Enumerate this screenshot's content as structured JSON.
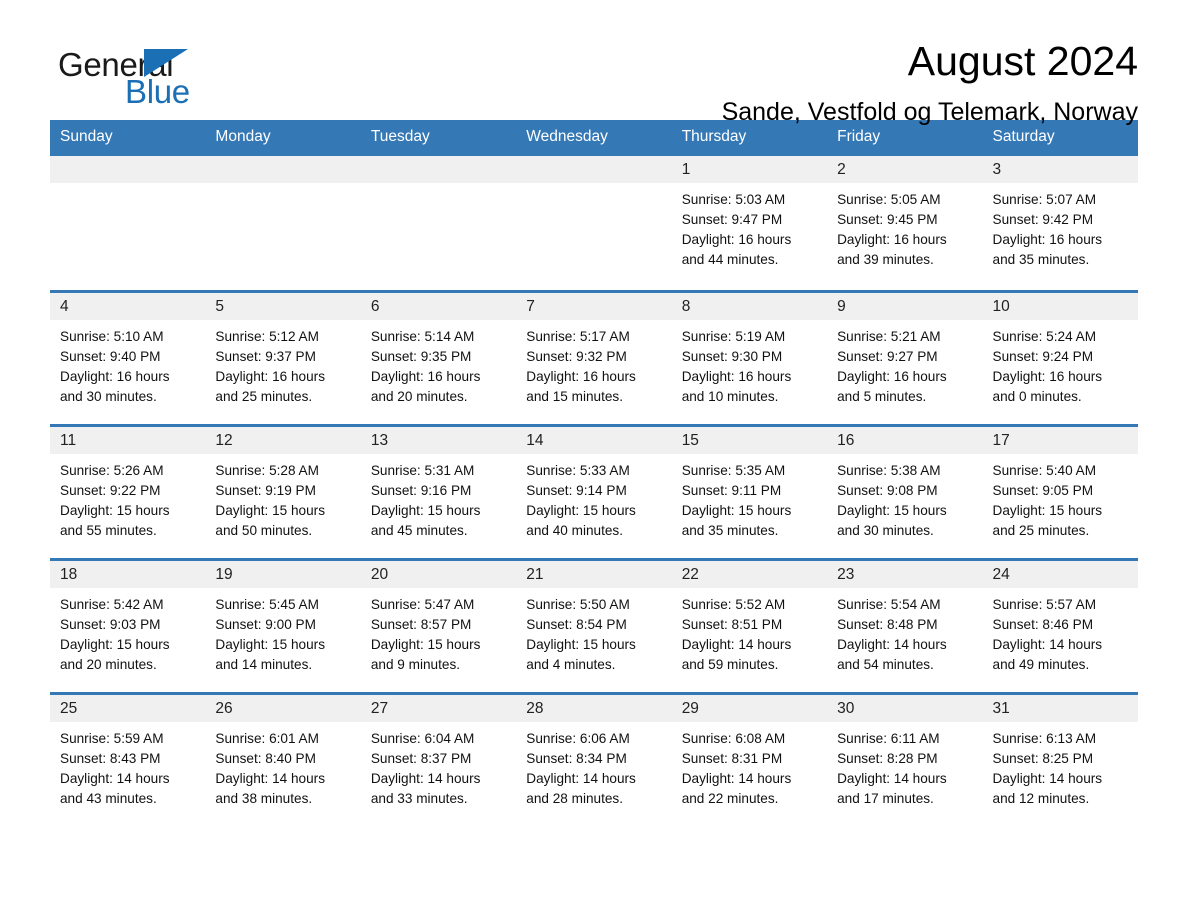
{
  "brand": {
    "word_one": "General",
    "word_two": "Blue",
    "flag_icon": "triangle-flag-icon"
  },
  "header": {
    "month_title": "August 2024",
    "location": "Sande, Vestfold og Telemark, Norway"
  },
  "colors": {
    "header_blue": "#3478b5",
    "brand_blue": "#1b6fb5",
    "day_number_bg": "#f0f0f0",
    "page_bg": "#ffffff"
  },
  "calendar": {
    "weekdays": [
      "Sunday",
      "Monday",
      "Tuesday",
      "Wednesday",
      "Thursday",
      "Friday",
      "Saturday"
    ],
    "weeks": [
      [
        {
          "day": "",
          "sunrise": "",
          "sunset": "",
          "daylight": ""
        },
        {
          "day": "",
          "sunrise": "",
          "sunset": "",
          "daylight": ""
        },
        {
          "day": "",
          "sunrise": "",
          "sunset": "",
          "daylight": ""
        },
        {
          "day": "",
          "sunrise": "",
          "sunset": "",
          "daylight": ""
        },
        {
          "day": "1",
          "sunrise": "Sunrise: 5:03 AM",
          "sunset": "Sunset: 9:47 PM",
          "daylight": "Daylight: 16 hours and 44 minutes."
        },
        {
          "day": "2",
          "sunrise": "Sunrise: 5:05 AM",
          "sunset": "Sunset: 9:45 PM",
          "daylight": "Daylight: 16 hours and 39 minutes."
        },
        {
          "day": "3",
          "sunrise": "Sunrise: 5:07 AM",
          "sunset": "Sunset: 9:42 PM",
          "daylight": "Daylight: 16 hours and 35 minutes."
        }
      ],
      [
        {
          "day": "4",
          "sunrise": "Sunrise: 5:10 AM",
          "sunset": "Sunset: 9:40 PM",
          "daylight": "Daylight: 16 hours and 30 minutes."
        },
        {
          "day": "5",
          "sunrise": "Sunrise: 5:12 AM",
          "sunset": "Sunset: 9:37 PM",
          "daylight": "Daylight: 16 hours and 25 minutes."
        },
        {
          "day": "6",
          "sunrise": "Sunrise: 5:14 AM",
          "sunset": "Sunset: 9:35 PM",
          "daylight": "Daylight: 16 hours and 20 minutes."
        },
        {
          "day": "7",
          "sunrise": "Sunrise: 5:17 AM",
          "sunset": "Sunset: 9:32 PM",
          "daylight": "Daylight: 16 hours and 15 minutes."
        },
        {
          "day": "8",
          "sunrise": "Sunrise: 5:19 AM",
          "sunset": "Sunset: 9:30 PM",
          "daylight": "Daylight: 16 hours and 10 minutes."
        },
        {
          "day": "9",
          "sunrise": "Sunrise: 5:21 AM",
          "sunset": "Sunset: 9:27 PM",
          "daylight": "Daylight: 16 hours and 5 minutes."
        },
        {
          "day": "10",
          "sunrise": "Sunrise: 5:24 AM",
          "sunset": "Sunset: 9:24 PM",
          "daylight": "Daylight: 16 hours and 0 minutes."
        }
      ],
      [
        {
          "day": "11",
          "sunrise": "Sunrise: 5:26 AM",
          "sunset": "Sunset: 9:22 PM",
          "daylight": "Daylight: 15 hours and 55 minutes."
        },
        {
          "day": "12",
          "sunrise": "Sunrise: 5:28 AM",
          "sunset": "Sunset: 9:19 PM",
          "daylight": "Daylight: 15 hours and 50 minutes."
        },
        {
          "day": "13",
          "sunrise": "Sunrise: 5:31 AM",
          "sunset": "Sunset: 9:16 PM",
          "daylight": "Daylight: 15 hours and 45 minutes."
        },
        {
          "day": "14",
          "sunrise": "Sunrise: 5:33 AM",
          "sunset": "Sunset: 9:14 PM",
          "daylight": "Daylight: 15 hours and 40 minutes."
        },
        {
          "day": "15",
          "sunrise": "Sunrise: 5:35 AM",
          "sunset": "Sunset: 9:11 PM",
          "daylight": "Daylight: 15 hours and 35 minutes."
        },
        {
          "day": "16",
          "sunrise": "Sunrise: 5:38 AM",
          "sunset": "Sunset: 9:08 PM",
          "daylight": "Daylight: 15 hours and 30 minutes."
        },
        {
          "day": "17",
          "sunrise": "Sunrise: 5:40 AM",
          "sunset": "Sunset: 9:05 PM",
          "daylight": "Daylight: 15 hours and 25 minutes."
        }
      ],
      [
        {
          "day": "18",
          "sunrise": "Sunrise: 5:42 AM",
          "sunset": "Sunset: 9:03 PM",
          "daylight": "Daylight: 15 hours and 20 minutes."
        },
        {
          "day": "19",
          "sunrise": "Sunrise: 5:45 AM",
          "sunset": "Sunset: 9:00 PM",
          "daylight": "Daylight: 15 hours and 14 minutes."
        },
        {
          "day": "20",
          "sunrise": "Sunrise: 5:47 AM",
          "sunset": "Sunset: 8:57 PM",
          "daylight": "Daylight: 15 hours and 9 minutes."
        },
        {
          "day": "21",
          "sunrise": "Sunrise: 5:50 AM",
          "sunset": "Sunset: 8:54 PM",
          "daylight": "Daylight: 15 hours and 4 minutes."
        },
        {
          "day": "22",
          "sunrise": "Sunrise: 5:52 AM",
          "sunset": "Sunset: 8:51 PM",
          "daylight": "Daylight: 14 hours and 59 minutes."
        },
        {
          "day": "23",
          "sunrise": "Sunrise: 5:54 AM",
          "sunset": "Sunset: 8:48 PM",
          "daylight": "Daylight: 14 hours and 54 minutes."
        },
        {
          "day": "24",
          "sunrise": "Sunrise: 5:57 AM",
          "sunset": "Sunset: 8:46 PM",
          "daylight": "Daylight: 14 hours and 49 minutes."
        }
      ],
      [
        {
          "day": "25",
          "sunrise": "Sunrise: 5:59 AM",
          "sunset": "Sunset: 8:43 PM",
          "daylight": "Daylight: 14 hours and 43 minutes."
        },
        {
          "day": "26",
          "sunrise": "Sunrise: 6:01 AM",
          "sunset": "Sunset: 8:40 PM",
          "daylight": "Daylight: 14 hours and 38 minutes."
        },
        {
          "day": "27",
          "sunrise": "Sunrise: 6:04 AM",
          "sunset": "Sunset: 8:37 PM",
          "daylight": "Daylight: 14 hours and 33 minutes."
        },
        {
          "day": "28",
          "sunrise": "Sunrise: 6:06 AM",
          "sunset": "Sunset: 8:34 PM",
          "daylight": "Daylight: 14 hours and 28 minutes."
        },
        {
          "day": "29",
          "sunrise": "Sunrise: 6:08 AM",
          "sunset": "Sunset: 8:31 PM",
          "daylight": "Daylight: 14 hours and 22 minutes."
        },
        {
          "day": "30",
          "sunrise": "Sunrise: 6:11 AM",
          "sunset": "Sunset: 8:28 PM",
          "daylight": "Daylight: 14 hours and 17 minutes."
        },
        {
          "day": "31",
          "sunrise": "Sunrise: 6:13 AM",
          "sunset": "Sunset: 8:25 PM",
          "daylight": "Daylight: 14 hours and 12 minutes."
        }
      ]
    ]
  }
}
